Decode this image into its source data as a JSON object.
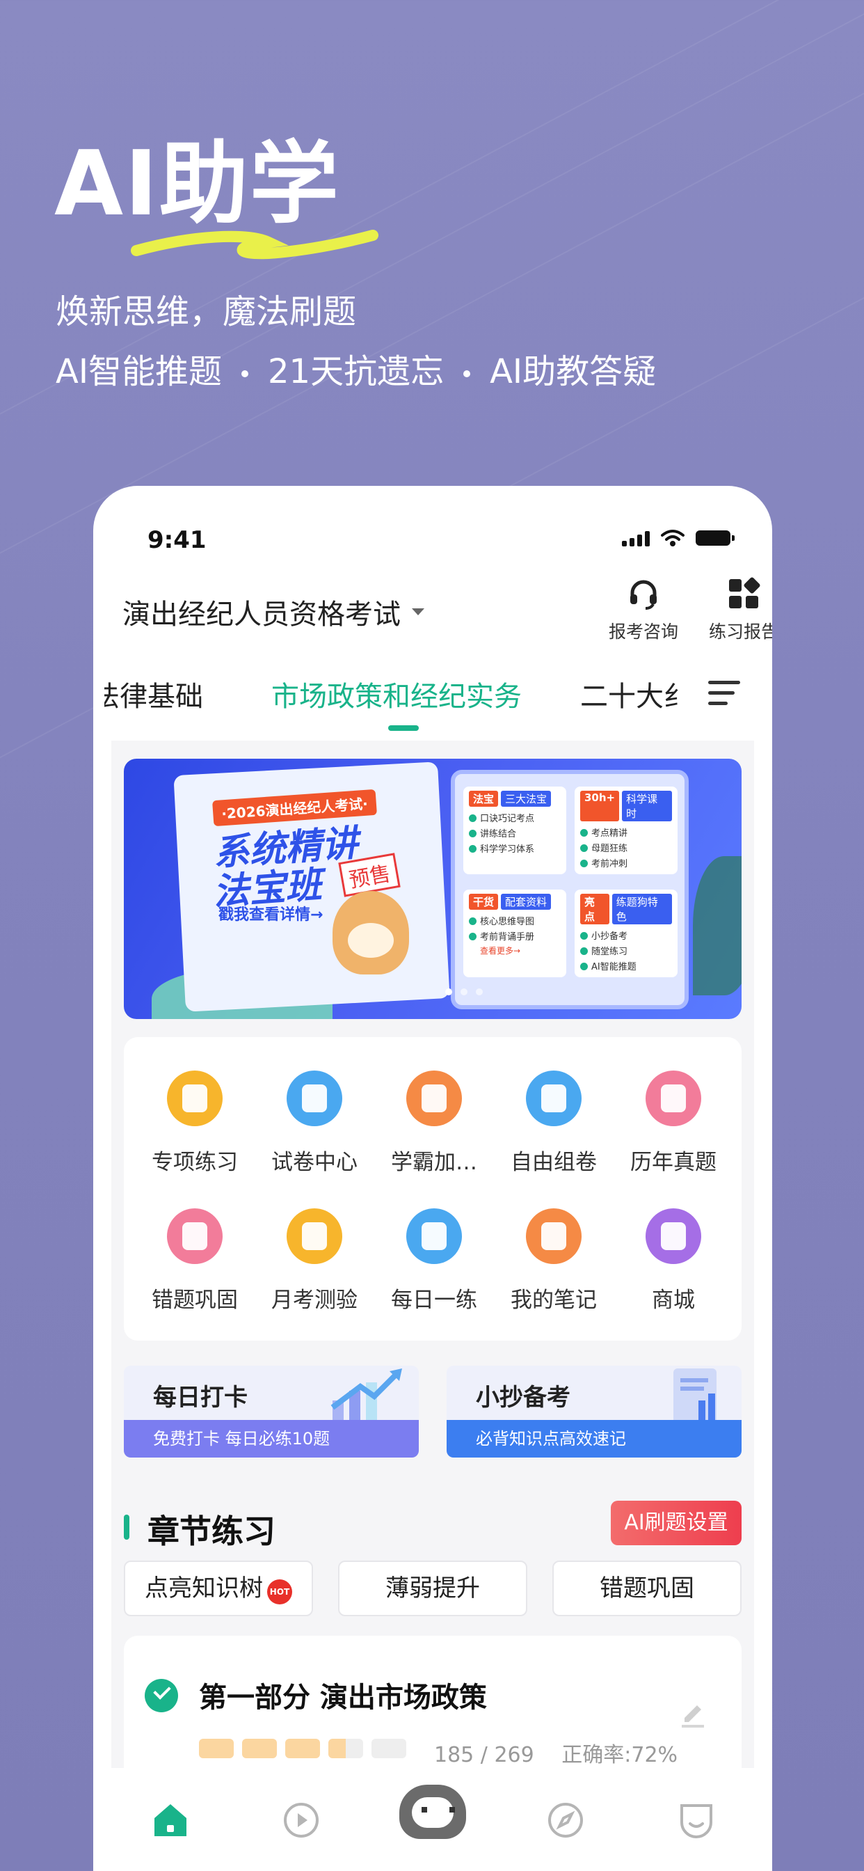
{
  "hero": {
    "title": "AI助学",
    "subtitle": "焕新思维，魔法刷题",
    "features": [
      "AI智能推题",
      "21天抗遗忘",
      "AI助教答疑"
    ]
  },
  "status_bar": {
    "time": "9:41"
  },
  "header": {
    "exam_name": "演出经纪人员资格考试",
    "consult_label": "报考咨询",
    "report_label": "练习报告"
  },
  "tabs": [
    {
      "label": "法律基础",
      "active": false
    },
    {
      "label": "市场政策和经纪实务",
      "active": true
    },
    {
      "label": "二十大纟",
      "active": false
    }
  ],
  "banner": {
    "tag": "·2026演出经纪人考试·",
    "title_line1": "系统精讲",
    "title_line2": "法宝班",
    "badge": "预售",
    "cta": "戳我查看详情→",
    "cards": [
      {
        "tag": "法宝",
        "sub": "三大法宝",
        "items": [
          "口诀巧记考点",
          "讲练结合",
          "科学学习体系"
        ]
      },
      {
        "tag": "30h+",
        "sub": "科学课时",
        "items": [
          "考点精讲",
          "母题狂练",
          "考前冲刺"
        ]
      },
      {
        "tag": "干货",
        "sub": "配套资料",
        "items": [
          "核心思维导图",
          "考前背诵手册"
        ],
        "more": "查看更多→"
      },
      {
        "tag": "亮点",
        "sub": "练题狗特色",
        "items": [
          "小抄备考",
          "随堂练习",
          "AI智能推题"
        ]
      }
    ]
  },
  "tools": [
    {
      "label": "专项练习",
      "icon": "notebook-icon",
      "color": "#f7b52c"
    },
    {
      "label": "试卷中心",
      "icon": "paper-icon",
      "color": "#4aa8f0"
    },
    {
      "label": "学霸加…",
      "icon": "heart-badge-icon",
      "color": "#f58a45"
    },
    {
      "label": "自由组卷",
      "icon": "card-plus-icon",
      "color": "#4aa8f0"
    },
    {
      "label": "历年真题",
      "icon": "mail-icon",
      "color": "#f27c9a"
    },
    {
      "label": "错题巩固",
      "icon": "error-book-icon",
      "color": "#f27c9a"
    },
    {
      "label": "月考测验",
      "icon": "trophy-icon",
      "color": "#f7b52c"
    },
    {
      "label": "每日一练",
      "icon": "pen-icon",
      "color": "#4aa8f0"
    },
    {
      "label": "我的笔记",
      "icon": "note-edit-icon",
      "color": "#f58a45"
    },
    {
      "label": "商城",
      "icon": "bag-icon",
      "color": "#a56ee6"
    }
  ],
  "promos": [
    {
      "title": "每日打卡",
      "subtitle": "免费打卡 每日必练10题",
      "color": "#7b7df0"
    },
    {
      "title": "小抄备考",
      "subtitle": "必背知识点高效速记",
      "color": "#3c7ef0"
    }
  ],
  "chapter_section": {
    "title": "章节练习",
    "ai_button": "AI刷题设置",
    "pills": [
      "点亮知识树",
      "薄弱提升",
      "错题巩固"
    ],
    "hot_badge": "HOT"
  },
  "chapter": {
    "title": "第一部分 演出市场政策",
    "progress_text": "185 / 269",
    "accuracy": "正确率:72%",
    "done": 185,
    "total": 269
  },
  "tabbar": [
    "home-icon",
    "play-icon",
    "robot-icon",
    "compass-icon",
    "profile-icon"
  ]
}
